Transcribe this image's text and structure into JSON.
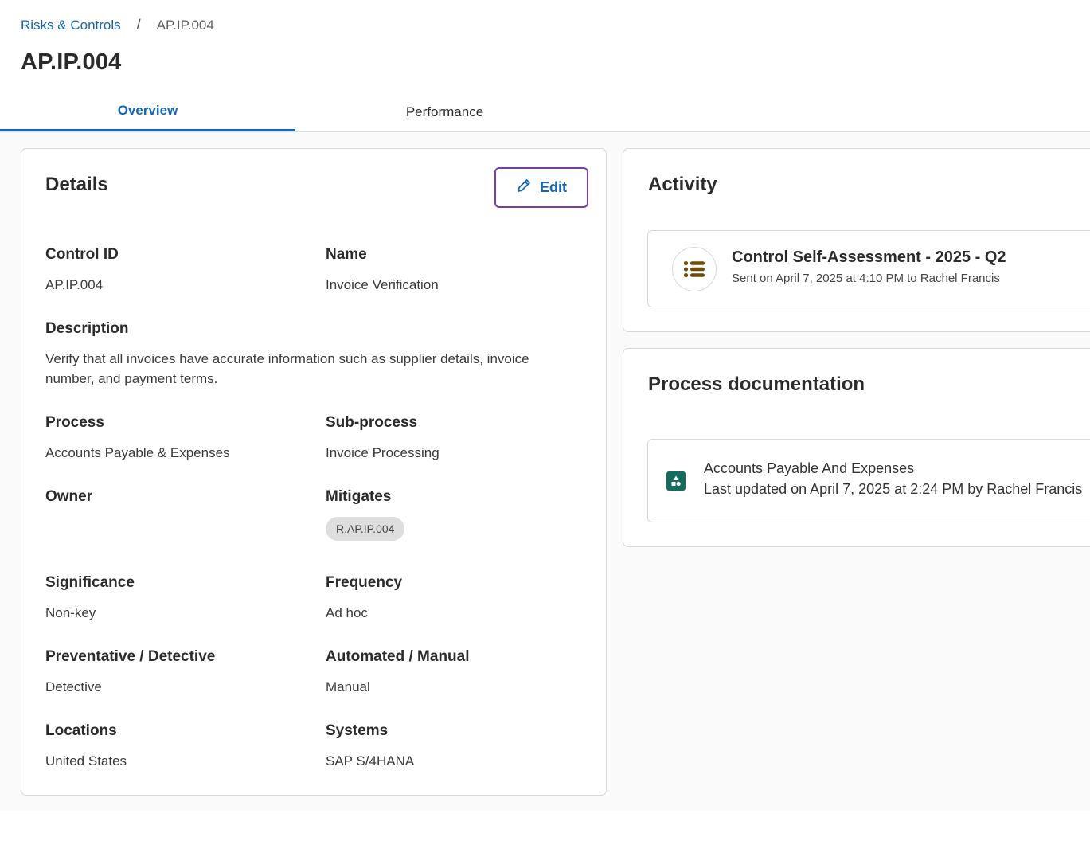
{
  "breadcrumb": {
    "parent": "Risks & Controls",
    "separator": "/",
    "current": "AP.IP.004"
  },
  "page_title": "AP.IP.004",
  "tabs": [
    {
      "label": "Overview",
      "active": true
    },
    {
      "label": "Performance",
      "active": false
    }
  ],
  "details": {
    "title": "Details",
    "edit_label": "Edit",
    "edit_icon": "pencil-icon",
    "fields": {
      "control_id": {
        "label": "Control ID",
        "value": "AP.IP.004"
      },
      "name": {
        "label": "Name",
        "value": "Invoice Verification"
      },
      "description": {
        "label": "Description",
        "value": "Verify that all invoices have accurate information such as supplier details, invoice number, and payment terms."
      },
      "process": {
        "label": "Process",
        "value": "Accounts Payable & Expenses"
      },
      "sub_process": {
        "label": "Sub-process",
        "value": "Invoice Processing"
      },
      "owner": {
        "label": "Owner",
        "value": ""
      },
      "mitigates": {
        "label": "Mitigates",
        "chip": "R.AP.IP.004"
      },
      "significance": {
        "label": "Significance",
        "value": "Non-key"
      },
      "frequency": {
        "label": "Frequency",
        "value": "Ad hoc"
      },
      "preventative_detective": {
        "label": "Preventative / Detective",
        "value": "Detective"
      },
      "automated_manual": {
        "label": "Automated / Manual",
        "value": "Manual"
      },
      "locations": {
        "label": "Locations",
        "value": "United States"
      },
      "systems": {
        "label": "Systems",
        "value": "SAP S/4HANA"
      }
    }
  },
  "activity": {
    "title": "Activity",
    "items": [
      {
        "icon": "list-icon",
        "title": "Control Self-Assessment - 2025 - Q2",
        "subtitle": "Sent on April 7, 2025 at 4:10 PM to Rachel Francis"
      }
    ]
  },
  "process_documentation": {
    "title": "Process documentation",
    "items": [
      {
        "icon": "shapes-icon",
        "title": "Accounts Payable And Expenses",
        "subtitle": "Last updated on April 7, 2025 at 2:24 PM by Rachel Francis"
      }
    ]
  },
  "colors": {
    "link": "#1565b0",
    "edit_border": "#7b3ea8",
    "activity_icon": "#6b4e0a",
    "doc_icon_bg": "#136b5c"
  }
}
